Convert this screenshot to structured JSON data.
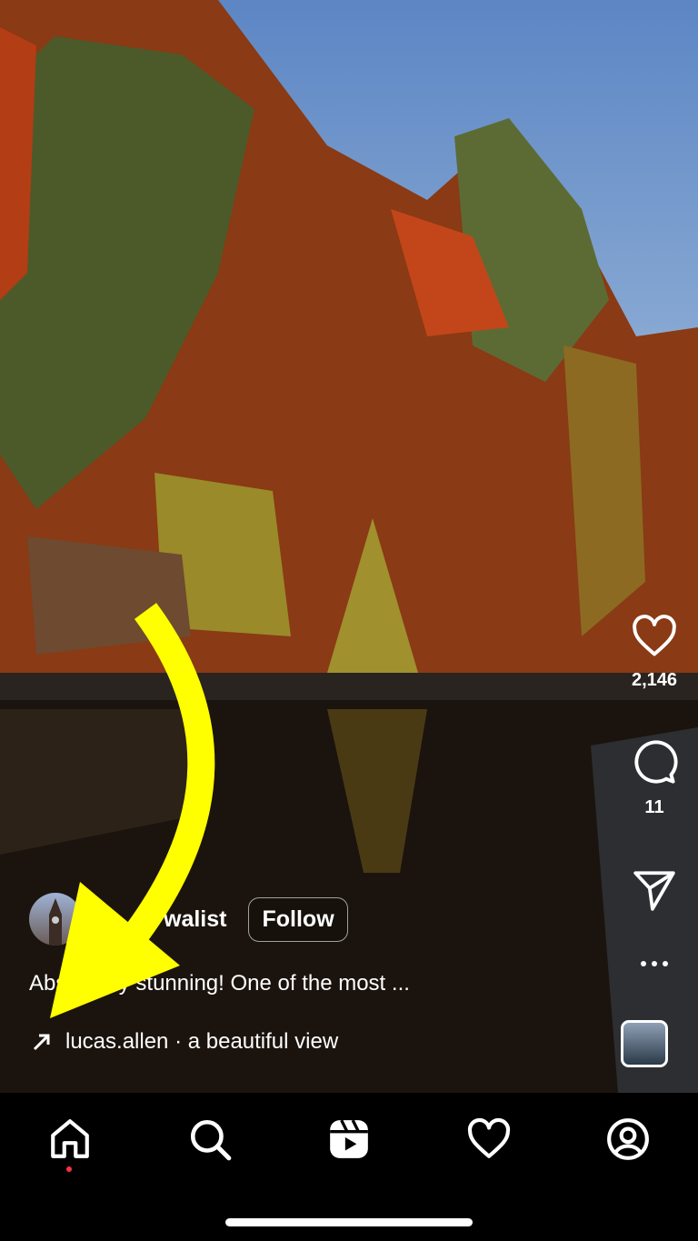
{
  "post": {
    "username": "walist",
    "follow_label": "Follow",
    "caption": "Absolutely stunning! One of the most ...",
    "audio_icon": "arrow-up-right-icon",
    "audio_label": "lucas.allen · a beautiful view"
  },
  "actions": {
    "likes": "2,146",
    "comments": "11"
  },
  "nav": {
    "items": [
      "home",
      "search",
      "reels",
      "activity",
      "profile"
    ]
  },
  "colors": {
    "annotation_arrow": "#ffff00",
    "notification_dot": "#ff3040",
    "nav_background": "#000000"
  }
}
